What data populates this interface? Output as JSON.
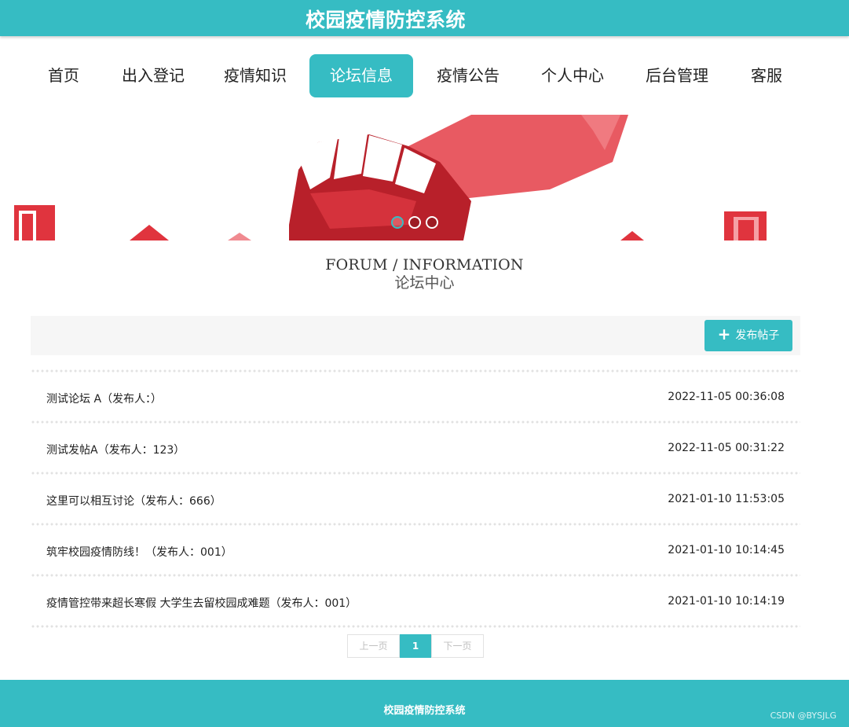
{
  "header": {
    "title": "校园疫情防控系统"
  },
  "nav": {
    "items": [
      {
        "label": "首页",
        "active": false
      },
      {
        "label": "出入登记",
        "active": false
      },
      {
        "label": "疫情知识",
        "active": false
      },
      {
        "label": "论坛信息",
        "active": true
      },
      {
        "label": "疫情公告",
        "active": false
      },
      {
        "label": "个人中心",
        "active": false
      },
      {
        "label": "后台管理",
        "active": false
      },
      {
        "label": "客服",
        "active": false
      }
    ]
  },
  "banner": {
    "slides": 3,
    "active_slide": 1
  },
  "section": {
    "title_en": "FORUM / INFORMATION",
    "title_zh": "论坛中心"
  },
  "toolbar": {
    "post_button_label": "发布帖子"
  },
  "posts": [
    {
      "title": "测试论坛 A（发布人：）",
      "date": "2022-11-05 00:36:08"
    },
    {
      "title": "测试发帖A（发布人：123）",
      "date": "2022-11-05 00:31:22"
    },
    {
      "title": "这里可以相互讨论（发布人：666）",
      "date": "2021-01-10 11:53:05"
    },
    {
      "title": "筑牢校园疫情防线！（发布人：001）",
      "date": "2021-01-10 10:14:45"
    },
    {
      "title": "疫情管控带来超长寒假 大学生去留校园成难题（发布人：001）",
      "date": "2021-01-10 10:14:19"
    }
  ],
  "pagination": {
    "prev_label": "上一页",
    "current": "1",
    "next_label": "下一页"
  },
  "footer": {
    "text": "校园疫情防控系统",
    "watermark": "CSDN @BYSJLG"
  },
  "colors": {
    "accent": "#36bcc3",
    "banner_red": "#e85a62",
    "banner_dark_red": "#b8202a"
  }
}
